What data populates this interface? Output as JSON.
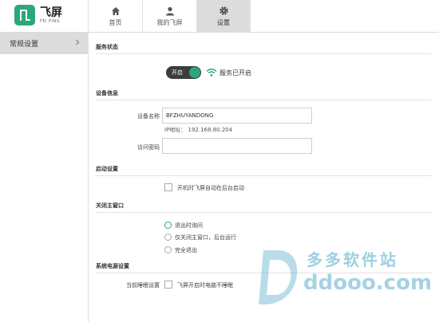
{
  "app": {
    "logo_cn": "飞屏",
    "logo_en": "FEI PING",
    "accent_color": "#2ca77a"
  },
  "nav": {
    "tabs": [
      {
        "label": "首页",
        "icon": "home-icon"
      },
      {
        "label": "我的飞屏",
        "icon": "user-icon"
      },
      {
        "label": "设置",
        "icon": "gear-icon",
        "active": true
      }
    ]
  },
  "sidebar": {
    "items": [
      {
        "label": "常规设置",
        "active": true
      }
    ]
  },
  "service": {
    "title": "服务状态",
    "toggle_label": "开启",
    "status": "服务已开启"
  },
  "device": {
    "title": "设备信息",
    "name_label": "设备名称",
    "name_value": "BFZHUYANDONG",
    "ip_text": "IP地址：  192.168.80.204",
    "password_label": "访问密码",
    "password_value": ""
  },
  "startup": {
    "title": "启动设置",
    "autostart_label": "开机时飞屏自动在后台启动",
    "autostart_checked": false
  },
  "close_main": {
    "title": "关闭主窗口",
    "options": [
      {
        "label": "退出时询问",
        "checked": true
      },
      {
        "label": "仅关闭主窗口，后台运行",
        "checked": false
      },
      {
        "label": "完全退出",
        "checked": false
      }
    ]
  },
  "power": {
    "title": "系统电源设置",
    "sleep_label": "当前睡眠设置",
    "nosleep_label": "飞屏开启时电脑不睡眠",
    "nosleep_checked": false
  },
  "watermark": {
    "cn": "多多软件站",
    "en": "ddooo.com"
  }
}
